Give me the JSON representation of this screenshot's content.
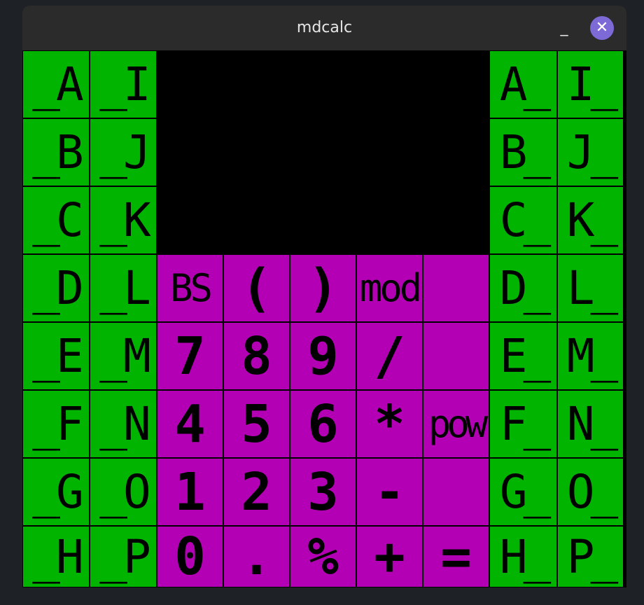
{
  "window": {
    "title": "mdcalc",
    "minimize_label": "_",
    "close_label": "✕",
    "close_color": "#7e6ad6"
  },
  "colors": {
    "register": "#00b400",
    "operator": "#b400b4",
    "display": "#000000"
  },
  "left_registers": {
    "col1": [
      "_A",
      "_B",
      "_C",
      "_D",
      "_E",
      "_F",
      "_G",
      "_H"
    ],
    "col2": [
      "_I",
      "_J",
      "_K",
      "_L",
      "_M",
      "_N",
      "_O",
      "_P"
    ]
  },
  "right_registers": {
    "col1": [
      "A_",
      "B_",
      "C_",
      "D_",
      "E_",
      "F_",
      "G_",
      "H_"
    ],
    "col2": [
      "I_",
      "J_",
      "K_",
      "L_",
      "M_",
      "N_",
      "O_",
      "P_"
    ]
  },
  "display": {
    "value": ""
  },
  "keypad": {
    "row1": [
      "BS",
      "(",
      ")",
      "mod",
      ""
    ],
    "row2": [
      "7",
      "8",
      "9",
      "/",
      ""
    ],
    "row3": [
      "4",
      "5",
      "6",
      "*",
      "pow"
    ],
    "row4": [
      "1",
      "2",
      "3",
      "-",
      ""
    ],
    "row5": [
      "0",
      ".",
      "%",
      "+",
      "="
    ]
  }
}
